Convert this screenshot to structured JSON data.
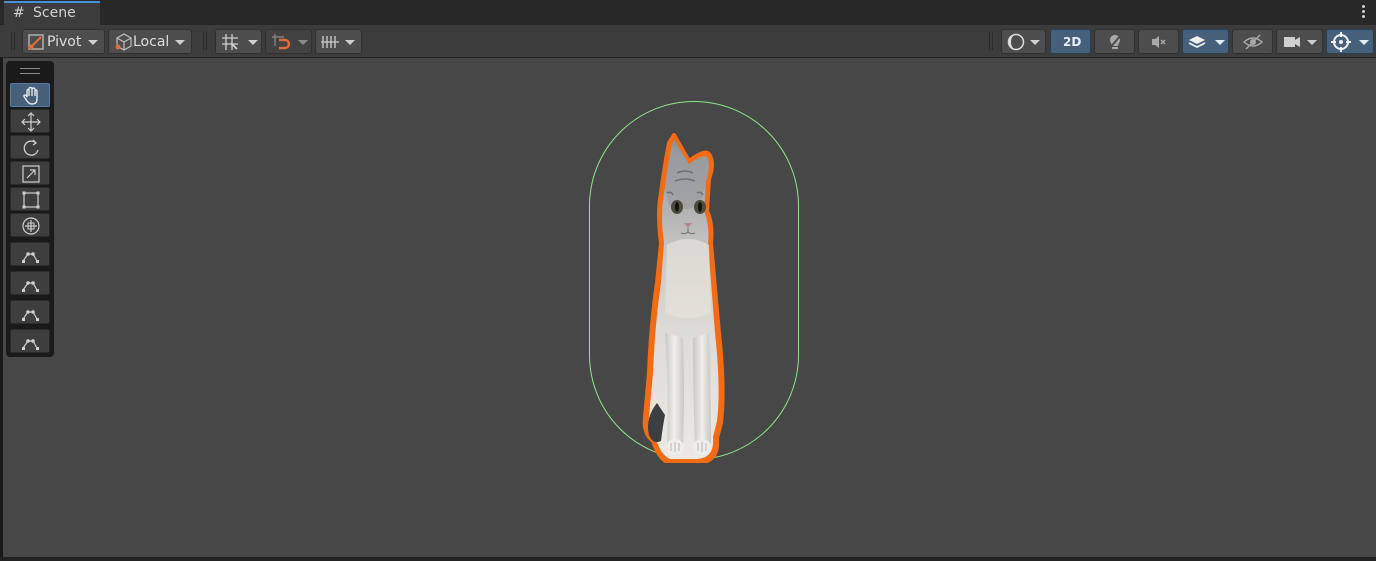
{
  "window": {
    "tab_title": "Scene"
  },
  "toolbar": {
    "pivot_label": "Pivot",
    "space_label": "Local",
    "mode_2d_label": "2D"
  },
  "tools": [
    {
      "name": "hand-tool",
      "icon": "hand-icon",
      "active": true
    },
    {
      "name": "move-tool",
      "icon": "move-arrows-icon",
      "active": false
    },
    {
      "name": "rotate-tool",
      "icon": "rotate-icon",
      "active": false
    },
    {
      "name": "scale-tool",
      "icon": "scale-icon",
      "active": false
    },
    {
      "name": "rect-tool",
      "icon": "rect-transform-icon",
      "active": false
    },
    {
      "name": "transform-tool",
      "icon": "transform-icon",
      "active": false
    },
    {
      "name": "custom-tool-1",
      "icon": "spline-icon",
      "active": false
    },
    {
      "name": "custom-tool-2",
      "icon": "spline-icon",
      "active": false
    },
    {
      "name": "custom-tool-3",
      "icon": "spline-icon",
      "active": false
    },
    {
      "name": "custom-tool-4",
      "icon": "spline-icon",
      "active": false
    }
  ],
  "scene": {
    "object": "cat-sprite",
    "collider_color": "#8fe48a",
    "outline_color": "#f36b13"
  },
  "colors": {
    "accent": "#46607c",
    "viewport": "#474747"
  }
}
